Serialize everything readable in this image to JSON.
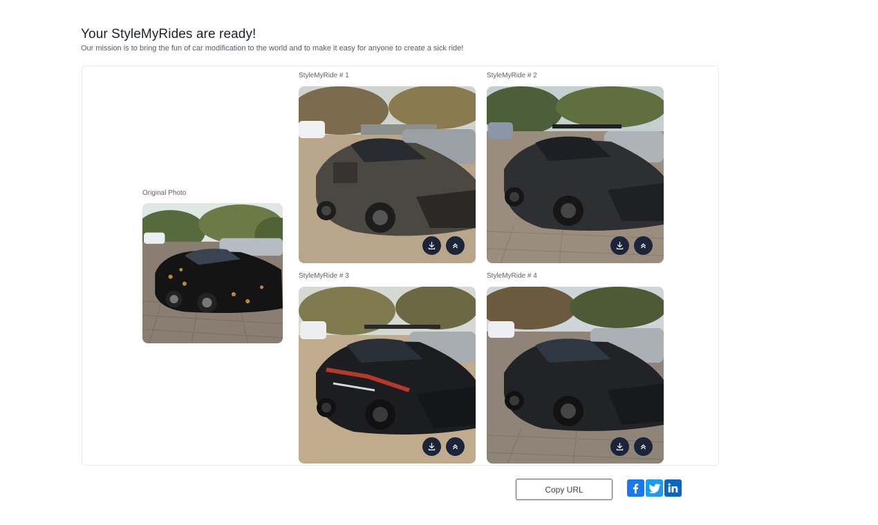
{
  "page": {
    "title": "Your StyleMyRides are ready!",
    "subtitle": "Our mission is to bring the fun of car modification to the world and to make it easy for anyone to create a sick ride!"
  },
  "original": {
    "label": "Original Photo"
  },
  "results": [
    {
      "label": "StyleMyRide # 1",
      "icons": [
        "download-icon",
        "chevrons-up-icon"
      ]
    },
    {
      "label": "StyleMyRide # 2",
      "icons": [
        "download-icon",
        "chevrons-up-icon"
      ]
    },
    {
      "label": "StyleMyRide # 3",
      "icons": [
        "download-icon",
        "chevrons-up-icon"
      ]
    },
    {
      "label": "StyleMyRide # 4",
      "icons": [
        "download-icon",
        "chevrons-up-icon"
      ]
    }
  ],
  "share": {
    "copy_label": "Copy URL",
    "networks": [
      {
        "name": "Facebook",
        "glyph": "f",
        "color": "#1877f2"
      },
      {
        "name": "Twitter",
        "glyph": "t",
        "color": "#1d9bf0"
      },
      {
        "name": "LinkedIn",
        "glyph": "in",
        "color": "#0a66c2"
      }
    ]
  },
  "colors": {
    "button_dark": "#1b2438",
    "panel_border": "#e6e8eb"
  }
}
